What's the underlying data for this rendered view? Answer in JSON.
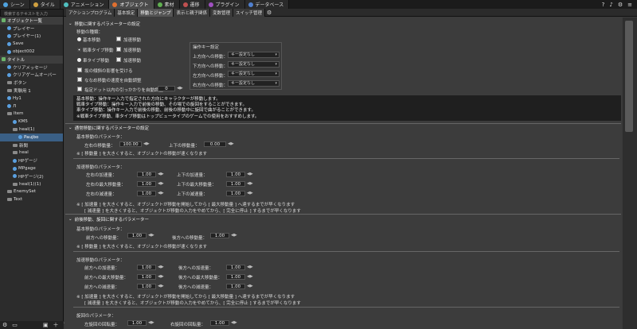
{
  "top_tabs": [
    {
      "label": "シーン",
      "color": "#4fa3e0"
    },
    {
      "label": "タイル",
      "color": "#d0a040"
    },
    {
      "label": "アニメーション",
      "color": "#50c0c0"
    },
    {
      "label": "オブジェクト",
      "color": "#e07030"
    },
    {
      "label": "素材",
      "color": "#60b050"
    },
    {
      "label": "遷移",
      "color": "#c05050"
    },
    {
      "label": "プラグイン",
      "color": "#a050c0"
    },
    {
      "label": "データベース",
      "color": "#5080d0"
    }
  ],
  "active_top_tab": 3,
  "search_placeholder": "検索するテキストを入力",
  "sub_tabs": [
    "アクションプログラム",
    "基本設定",
    "移動とジャンプ",
    "表示と親子関係",
    "変数管理",
    "スイッチ管理"
  ],
  "active_sub_tab": 2,
  "tree": [
    {
      "label": "オブジェクト一覧",
      "indent": 0,
      "type": "header"
    },
    {
      "label": "プレイヤー",
      "indent": 1,
      "type": "item"
    },
    {
      "label": "プレイヤー(1)",
      "indent": 1,
      "type": "item"
    },
    {
      "label": "Save",
      "indent": 1,
      "type": "item"
    },
    {
      "label": "object002",
      "indent": 1,
      "type": "item"
    },
    {
      "label": "タイトル",
      "indent": 0,
      "type": "header"
    },
    {
      "label": "クリアメッセージ",
      "indent": 1,
      "type": "item"
    },
    {
      "label": "クリアゲームオーバー",
      "indent": 1,
      "type": "item"
    },
    {
      "label": "ボタン",
      "indent": 1,
      "type": "folder"
    },
    {
      "label": "実験用 1",
      "indent": 1,
      "type": "folder"
    },
    {
      "label": "Hy1",
      "indent": 1,
      "type": "item"
    },
    {
      "label": "Л",
      "indent": 1,
      "type": "item"
    },
    {
      "label": "Item",
      "indent": 1,
      "type": "folder"
    },
    {
      "label": "KM5",
      "indent": 2,
      "type": "item"
    },
    {
      "label": "heal(1)",
      "indent": 2,
      "type": "folder"
    },
    {
      "label": "Paujbo",
      "indent": 3,
      "type": "sel"
    },
    {
      "label": "新聞",
      "indent": 2,
      "type": "folder"
    },
    {
      "label": "heal",
      "indent": 2,
      "type": "folder"
    },
    {
      "label": "HPゲージ",
      "indent": 2,
      "type": "item"
    },
    {
      "label": "MPgage",
      "indent": 2,
      "type": "item"
    },
    {
      "label": "HPゲージ(2)",
      "indent": 2,
      "type": "item"
    },
    {
      "label": "heal(1)(1)",
      "indent": 2,
      "type": "folder"
    },
    {
      "label": "EnemySet",
      "indent": 1,
      "type": "folder"
    },
    {
      "label": "Text",
      "indent": 1,
      "type": "folder"
    }
  ],
  "sec1": {
    "title": "移動に関するパラメーターの設定",
    "move_type_label": "移動の種類：",
    "options": [
      {
        "label": "基本移動",
        "accel": "加速移動",
        "selected": false
      },
      {
        "label": "戦車タイプ移動",
        "accel": "加速移動",
        "selected": true
      },
      {
        "label": "車タイプ移動",
        "accel": "加速移動",
        "selected": false
      }
    ],
    "checks": [
      "坂の傾斜の影響を受ける",
      "ななめ移動の速度を自動調整",
      "指定ドット以内の引っかかりを自動調整"
    ],
    "dot_value": "0",
    "key_title": "操作キー設定",
    "keys": [
      {
        "label": "上方向への移動：",
        "value": "キー設定なし"
      },
      {
        "label": "下方向への移動：",
        "value": "キー設定なし"
      },
      {
        "label": "左方向への移動：",
        "value": "キー設定なし"
      },
      {
        "label": "右方向への移動：",
        "value": "キー設定なし"
      }
    ],
    "desc": [
      "基本移動：操作キー入力で指定された方向にキャラクターが移動します。",
      "戦車タイプ移動：操作キー入力で前後の移動、その場での旋回をすることができます。",
      "車タイプ移動：操作キー入力で前後の移動、前後の移動中に旋回で曲がることができます。",
      "※戦車タイプ移動、車タイプ移動はトップビュータイプのゲームでの使用をおすすめします。"
    ]
  },
  "sec2": {
    "title": "通常移動に関するパラメーターの設定",
    "basic_label": "基本移動のパラメータ：",
    "lr_label": "左右の移動量：",
    "lr_value": "100.00",
    "ud_label": "上下の移動量：",
    "ud_value": "0.00",
    "note1": "※ [ 移動量 ] を大きくすると、オブジェクトの移動が速くなります",
    "accel_label": "加速移動のパラメータ：",
    "accel_rows": [
      {
        "l": "左右の加速量：",
        "lv": "1.00",
        "r": "上下の加速量：",
        "rv": "1.00"
      },
      {
        "l": "左右の最大移動量：",
        "lv": "1.00",
        "r": "上下の最大移動量：",
        "rv": "1.00"
      },
      {
        "l": "左右の減速量：",
        "lv": "1.00",
        "r": "上下の減速量：",
        "rv": "1.00"
      }
    ],
    "note2": "※ [ 加速量 ] を大きくすると、オブジェクトが移動を開始してから [ 最大移動量 ] へ達するまでが早くなります",
    "note3": "[ 減速量 ] を大きくすると、オブジェクトが移動の入力をやめてから、[ 完全に停止 ] するまでが早くなります"
  },
  "sec3": {
    "title": "前後移動、旋回に関するパラメーター",
    "basic_label": "基本移動のパラメータ：",
    "f_label": "前方への移動量：",
    "f_value": "1.00",
    "b_label": "後方への移動量：",
    "b_value": "1.00",
    "note1": "※ [ 移動量 ] を大きくすると、オブジェクトの移動が速くなります",
    "accel_label": "加速移動のパラメータ：",
    "accel_rows": [
      {
        "l": "前方への加速量：",
        "lv": "1.00",
        "r": "後方への加速量：",
        "rv": "1.00"
      },
      {
        "l": "前方への最大移動量：",
        "lv": "1.00",
        "r": "後方への最大移動量：",
        "rv": "1.00"
      },
      {
        "l": "前方への減速量：",
        "lv": "1.00",
        "r": "後方への減速量：",
        "rv": "1.00"
      }
    ],
    "note2": "※ [ 加速量 ] を大きくすると、オブジェクトが移動を開始してから [ 最大移動量 ] へ達するまでが早くなります",
    "note3": "[ 減速量 ] を大きくすると、オブジェクトが移動の入力をやめてから、[ 完全に停止 ] するまでが早くなります",
    "turn_label": "旋回のパラメータ：",
    "lt_label": "左旋回の回転量：",
    "lt_value": "1.00",
    "rt_label": "右旋回の回転量：",
    "rt_value": "1.00"
  }
}
